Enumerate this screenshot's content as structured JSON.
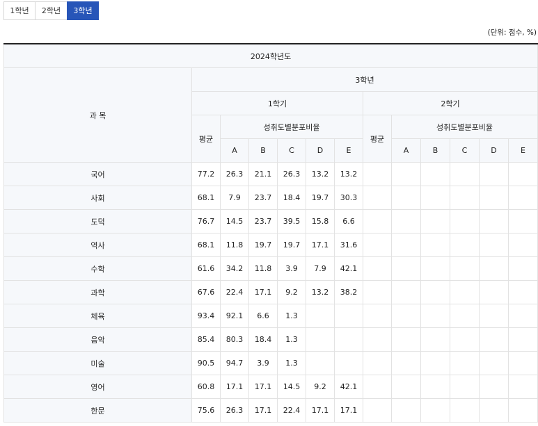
{
  "tabs": [
    {
      "label": "1학년",
      "active": false
    },
    {
      "label": "2학년",
      "active": false
    },
    {
      "label": "3학년",
      "active": true
    }
  ],
  "unit_note": "(단위: 점수, %)",
  "table": {
    "year_header": "2024학년도",
    "subject_header": "과 목",
    "grade_header": "3학년",
    "semester1": "1학기",
    "semester2": "2학기",
    "avg_label": "평균",
    "dist_label": "성취도별분포비율",
    "grades": [
      "A",
      "B",
      "C",
      "D",
      "E"
    ],
    "rows": [
      {
        "subject": "국어",
        "s1": [
          "77.2",
          "26.3",
          "21.1",
          "26.3",
          "13.2",
          "13.2"
        ],
        "s2": [
          "",
          "",
          "",
          "",
          "",
          ""
        ]
      },
      {
        "subject": "사회",
        "s1": [
          "68.1",
          "7.9",
          "23.7",
          "18.4",
          "19.7",
          "30.3"
        ],
        "s2": [
          "",
          "",
          "",
          "",
          "",
          ""
        ]
      },
      {
        "subject": "도덕",
        "s1": [
          "76.7",
          "14.5",
          "23.7",
          "39.5",
          "15.8",
          "6.6"
        ],
        "s2": [
          "",
          "",
          "",
          "",
          "",
          ""
        ]
      },
      {
        "subject": "역사",
        "s1": [
          "68.1",
          "11.8",
          "19.7",
          "19.7",
          "17.1",
          "31.6"
        ],
        "s2": [
          "",
          "",
          "",
          "",
          "",
          ""
        ]
      },
      {
        "subject": "수학",
        "s1": [
          "61.6",
          "34.2",
          "11.8",
          "3.9",
          "7.9",
          "42.1"
        ],
        "s2": [
          "",
          "",
          "",
          "",
          "",
          ""
        ]
      },
      {
        "subject": "과학",
        "s1": [
          "67.6",
          "22.4",
          "17.1",
          "9.2",
          "13.2",
          "38.2"
        ],
        "s2": [
          "",
          "",
          "",
          "",
          "",
          ""
        ]
      },
      {
        "subject": "체육",
        "s1": [
          "93.4",
          "92.1",
          "6.6",
          "1.3",
          "",
          ""
        ],
        "s2": [
          "",
          "",
          "",
          "",
          "",
          ""
        ]
      },
      {
        "subject": "음악",
        "s1": [
          "85.4",
          "80.3",
          "18.4",
          "1.3",
          "",
          ""
        ],
        "s2": [
          "",
          "",
          "",
          "",
          "",
          ""
        ]
      },
      {
        "subject": "미술",
        "s1": [
          "90.5",
          "94.7",
          "3.9",
          "1.3",
          "",
          ""
        ],
        "s2": [
          "",
          "",
          "",
          "",
          "",
          ""
        ]
      },
      {
        "subject": "영어",
        "s1": [
          "60.8",
          "17.1",
          "17.1",
          "14.5",
          "9.2",
          "42.1"
        ],
        "s2": [
          "",
          "",
          "",
          "",
          "",
          ""
        ]
      },
      {
        "subject": "한문",
        "s1": [
          "75.6",
          "26.3",
          "17.1",
          "22.4",
          "17.1",
          "17.1"
        ],
        "s2": [
          "",
          "",
          "",
          "",
          "",
          ""
        ]
      }
    ]
  }
}
